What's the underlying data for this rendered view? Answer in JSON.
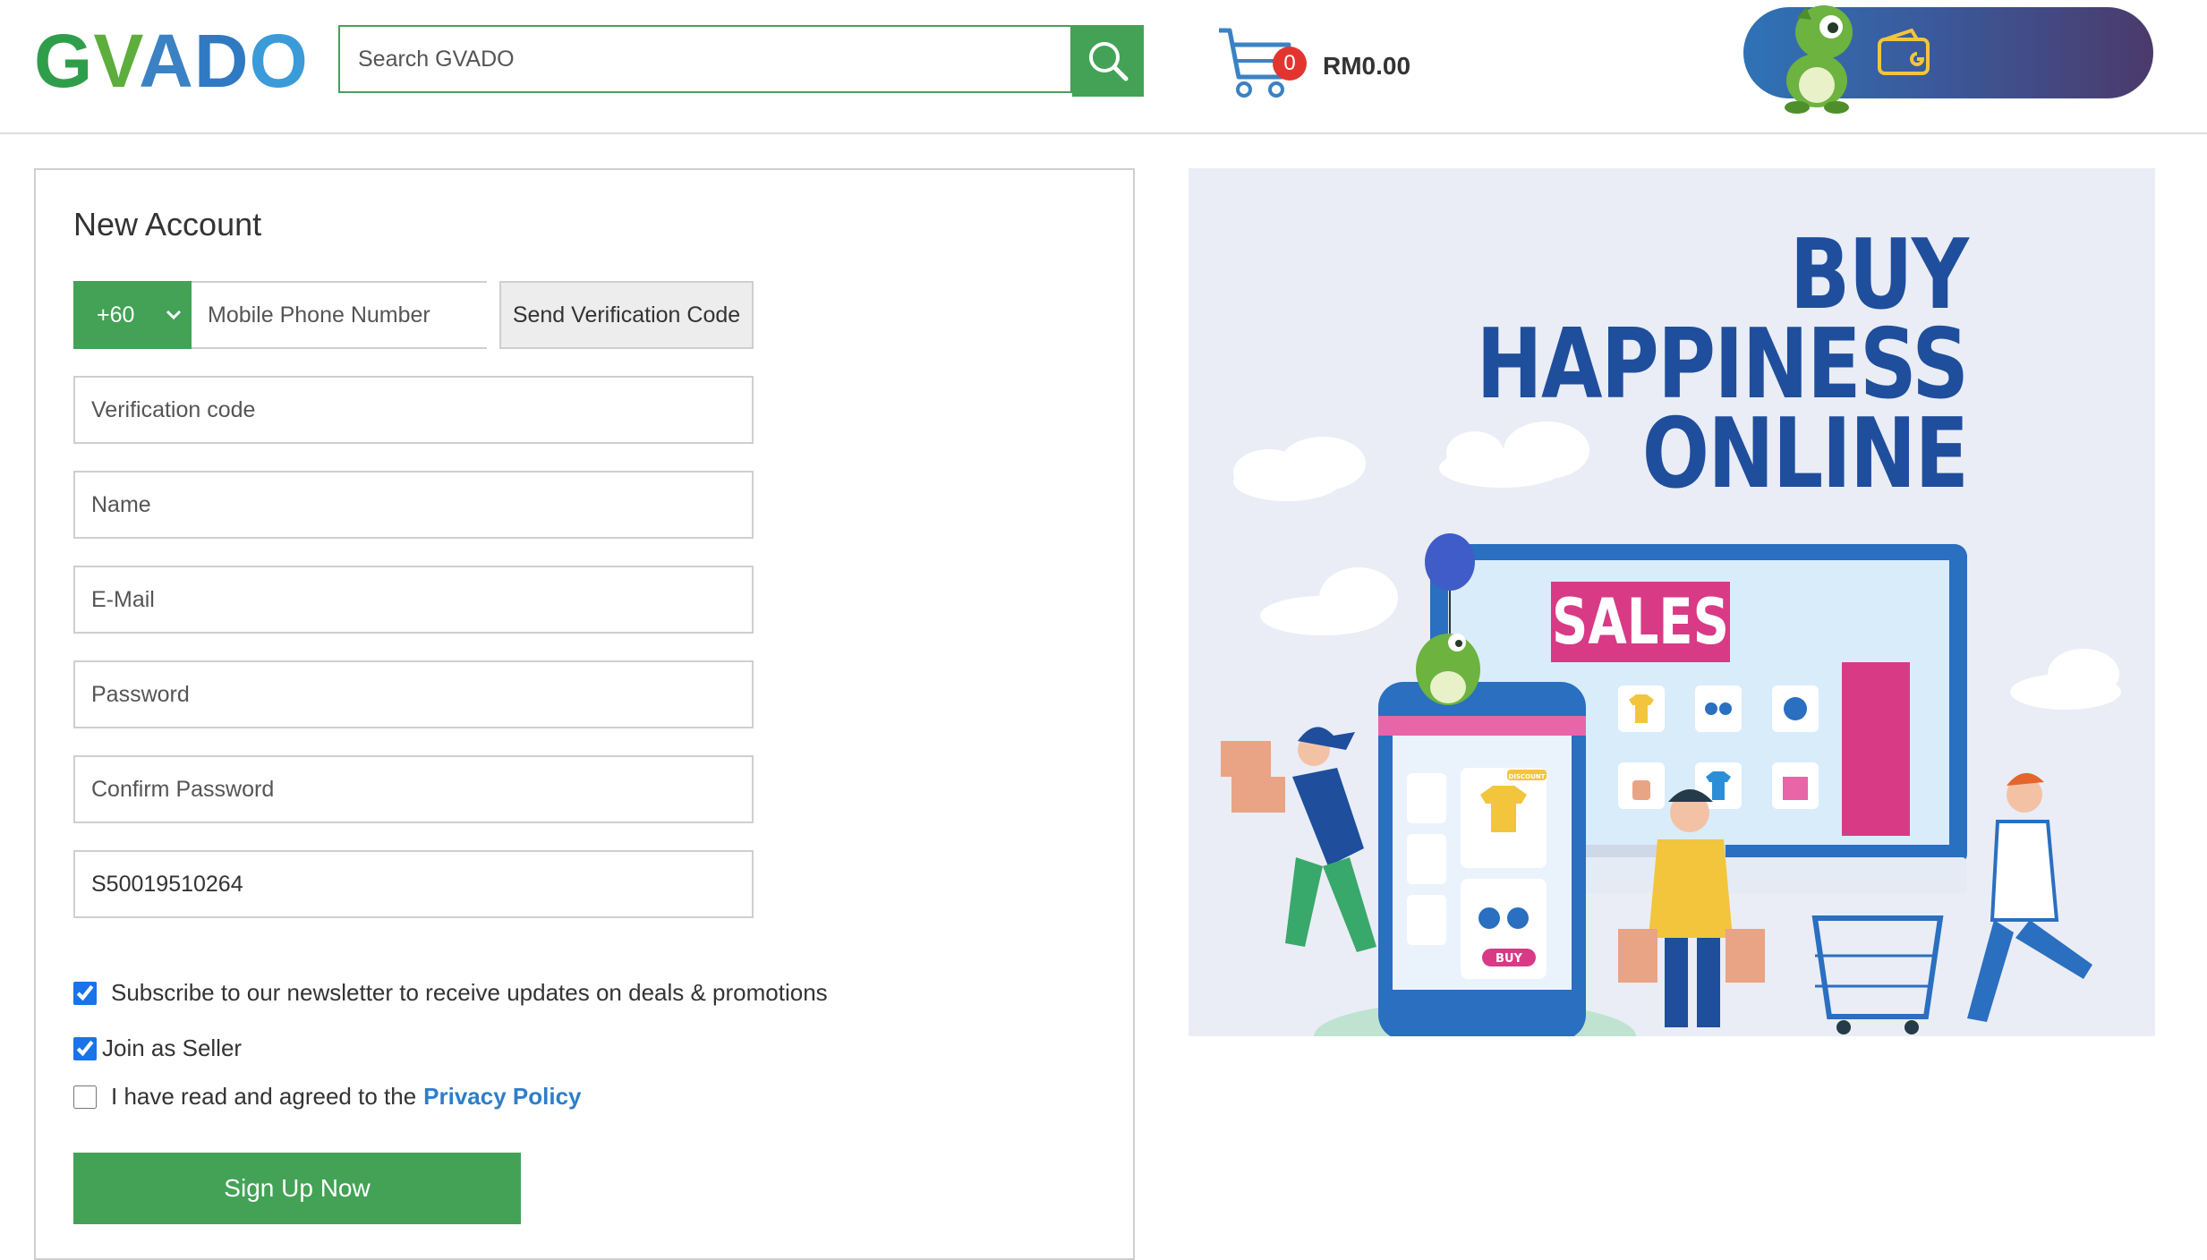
{
  "header": {
    "logo_letters": [
      "G",
      "V",
      "A",
      "D",
      "O"
    ],
    "search_placeholder": "Search GVADO",
    "cart_count": "0",
    "cart_total": "RM0.00"
  },
  "form": {
    "title": "New Account",
    "country_code": "+60",
    "phone_placeholder": "Mobile Phone Number",
    "send_code_label": "Send Verification Code",
    "verification_placeholder": "Verification code",
    "name_placeholder": "Name",
    "email_placeholder": "E-Mail",
    "password_placeholder": "Password",
    "confirm_password_placeholder": "Confirm Password",
    "referral_value": "S50019510264",
    "newsletter_label": "Subscribe to our newsletter to receive updates on deals & promotions",
    "newsletter_checked": true,
    "seller_label": "Join as Seller",
    "seller_checked": true,
    "policy_prefix": "I have read and agreed to the",
    "policy_link": "Privacy Policy",
    "policy_checked": false,
    "signup_label": "Sign Up Now"
  },
  "banner": {
    "line1": "BUY",
    "line2": "HAPPINESS",
    "line3": "ONLINE",
    "sales_sign": "SALES",
    "buy_tag": "BUY",
    "discount_tag": "DISCOUNT"
  },
  "colors": {
    "brand_green": "#43a256",
    "brand_blue": "#1f4e9c",
    "accent_pink": "#d83a86",
    "link_blue": "#2f7ec9"
  }
}
